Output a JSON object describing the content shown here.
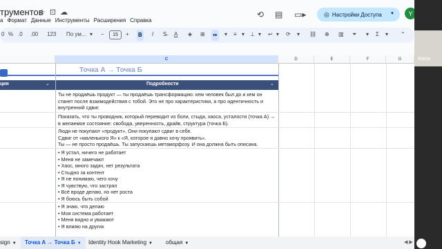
{
  "app": {
    "doc_title": "трументов",
    "menu": [
      "а",
      "Формат",
      "Данные",
      "Инструменты",
      "Расширения",
      "Справка"
    ],
    "share_label": "Настройки Доступа",
    "avatar_letter": "Y"
  },
  "toolbar": {
    "zoom": "0",
    "pct": "%",
    "dec1": ".0",
    "dec2": ".00",
    "num_fmt": "123",
    "font": "По ум...",
    "minus": "−",
    "font_size": "15",
    "plus": "+",
    "bold": "B",
    "italic": "I",
    "strike": "S̶",
    "text_color": "A"
  },
  "video": {
    "label": "Marta"
  },
  "columns": [
    "C",
    "D",
    "E",
    "F",
    "G"
  ],
  "sheet": {
    "big_header": "Точка А → Точка Б",
    "header_left": "ция",
    "header_mid": "Подробности",
    "blocks": [
      "Ты не продаёшь продукт — ты продаёшь трансформацию: кем человек был до и кем он станет после взаимодействия с тобой. Это не про характеристики, а про идентичность и внутренний сдвиг.",
      "Показать, что ты проводник, который переводит из боли, стыда, хаоса, усталости (точка А) → в желаемое состояние: свобода, уверенность, драйв, структура (точка Б).",
      "Люди не покупают «продукт». Они покупают сдвиг в себе.\nСдвиг от «маленького Я» к «Я, которое я давно хочу проявить».\nТы — не просто продаёшь. Ты запускаешь метаморфозу. И она должна быть описана.",
      "• Я устал, ничего не работает\n• Меня не замечают\n• Хаос, много задач, нет результата\n• Стыдно за контент\n• Я не понимаю, чего хочу\n• Я чувствую, что застрял\n• Всё вроде делаю, но нет роста\n• Я боюсь быть собой",
      "• Я знаю, что делаю\n• Моя система работает\n• Меня видно и уважают\n• Я влияю на других"
    ]
  },
  "tabs": {
    "t1": "sign",
    "t2": "Точка А → Точка Б",
    "t3": "Identity Hook Marketing",
    "t4": "общая"
  }
}
